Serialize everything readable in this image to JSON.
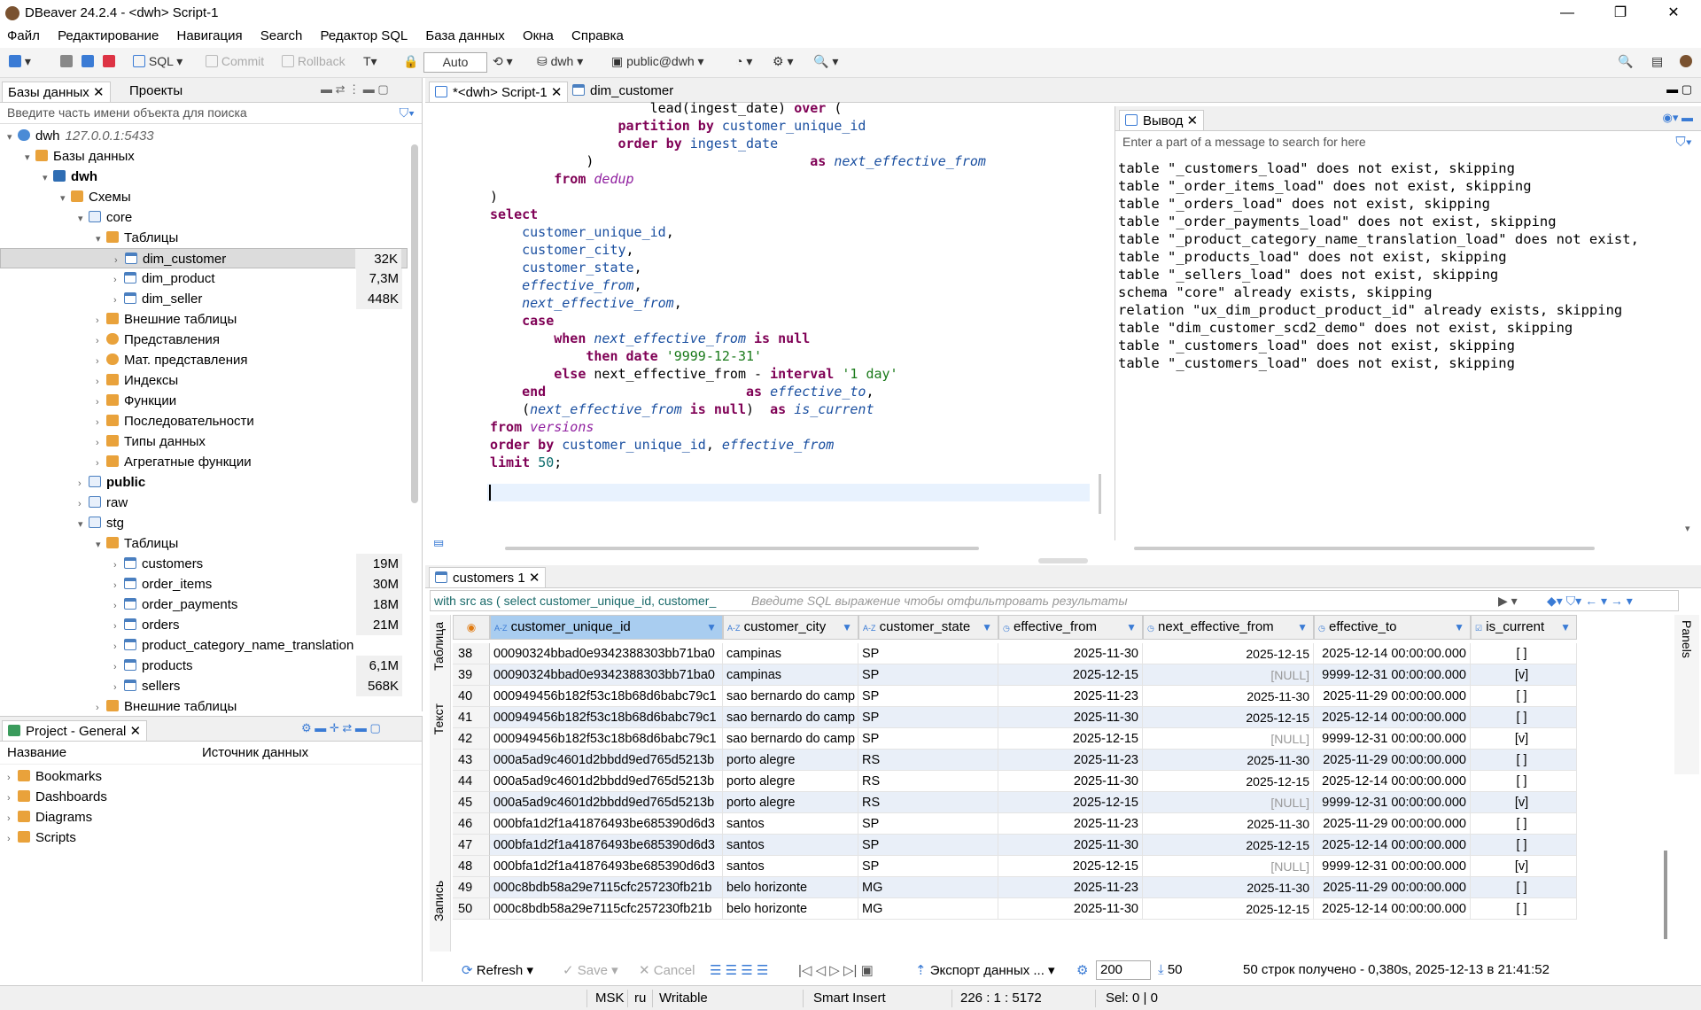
{
  "window": {
    "title": "DBeaver 24.2.4 - <dwh> Script-1"
  },
  "menu": [
    "Файл",
    "Редактирование",
    "Навигация",
    "Search",
    "Редактор SQL",
    "База данных",
    "Окна",
    "Справка"
  ],
  "toolbar": {
    "sql": "SQL",
    "commit": "Commit",
    "rollback": "Rollback",
    "mode": "Auto",
    "datasource": "dwh",
    "schema": "public@dwh"
  },
  "left": {
    "tab_db": "Базы данных",
    "tab_projects": "Проекты",
    "search_placeholder": "Введите часть имени объекта для поиска",
    "tree": [
      {
        "label": "dwh",
        "extra": "127.0.0.1:5433",
        "level": 0,
        "icon": "conn",
        "open": true
      },
      {
        "label": "Базы данных",
        "level": 1,
        "icon": "fold",
        "open": true
      },
      {
        "label": "dwh",
        "level": 2,
        "icon": "db",
        "open": true,
        "bold": true
      },
      {
        "label": "Схемы",
        "level": 3,
        "icon": "fold",
        "open": true
      },
      {
        "label": "core",
        "level": 4,
        "icon": "schema",
        "open": true
      },
      {
        "label": "Таблицы",
        "level": 5,
        "icon": "fold",
        "open": true
      },
      {
        "label": "dim_customer",
        "level": 6,
        "icon": "table",
        "size": "32K",
        "sel": true
      },
      {
        "label": "dim_product",
        "level": 6,
        "icon": "table",
        "size": "7,3M"
      },
      {
        "label": "dim_seller",
        "level": 6,
        "icon": "table",
        "size": "448K"
      },
      {
        "label": "Внешние таблицы",
        "level": 5,
        "icon": "fold"
      },
      {
        "label": "Представления",
        "level": 5,
        "icon": "view"
      },
      {
        "label": "Мат. представления",
        "level": 5,
        "icon": "view"
      },
      {
        "label": "Индексы",
        "level": 5,
        "icon": "fold"
      },
      {
        "label": "Функции",
        "level": 5,
        "icon": "fold"
      },
      {
        "label": "Последовательности",
        "level": 5,
        "icon": "fold"
      },
      {
        "label": "Типы данных",
        "level": 5,
        "icon": "fold"
      },
      {
        "label": "Агрегатные функции",
        "level": 5,
        "icon": "fold"
      },
      {
        "label": "public",
        "level": 4,
        "icon": "schema",
        "bold": true
      },
      {
        "label": "raw",
        "level": 4,
        "icon": "schema"
      },
      {
        "label": "stg",
        "level": 4,
        "icon": "schema",
        "open": true
      },
      {
        "label": "Таблицы",
        "level": 5,
        "icon": "fold",
        "open": true
      },
      {
        "label": "customers",
        "level": 6,
        "icon": "table",
        "size": "19M"
      },
      {
        "label": "order_items",
        "level": 6,
        "icon": "table",
        "size": "30M"
      },
      {
        "label": "order_payments",
        "level": 6,
        "icon": "table",
        "size": "18M"
      },
      {
        "label": "orders",
        "level": 6,
        "icon": "table",
        "size": "21M"
      },
      {
        "label": "product_category_name_translation",
        "level": 6,
        "icon": "table"
      },
      {
        "label": "products",
        "level": 6,
        "icon": "table",
        "size": "6,1M"
      },
      {
        "label": "sellers",
        "level": 6,
        "icon": "table",
        "size": "568K"
      },
      {
        "label": "Внешние таблицы",
        "level": 5,
        "icon": "fold"
      }
    ]
  },
  "project": {
    "tab": "Project - General",
    "col_name": "Название",
    "col_source": "Источник данных",
    "items": [
      "Bookmarks",
      "Dashboards",
      "Diagrams",
      "Scripts"
    ]
  },
  "editor": {
    "tab1": "*<dwh> Script-1",
    "tab2": "dim_customer"
  },
  "output": {
    "tab": "Вывод",
    "search_placeholder": "Enter a part of a message to search for here",
    "lines": [
      "table \"_customers_load\" does not exist, skipping",
      "table \"_order_items_load\" does not exist, skipping",
      "table \"_orders_load\" does not exist, skipping",
      "table \"_order_payments_load\" does not exist, skipping",
      "table \"_product_category_name_translation_load\" does not exist,",
      "table \"_products_load\" does not exist, skipping",
      "table \"_sellers_load\" does not exist, skipping",
      "schema \"core\" already exists, skipping",
      "relation \"ux_dim_product_product_id\" already exists, skipping",
      "table \"dim_customer_scd2_demo\" does not exist, skipping",
      "table \"_customers_load\" does not exist, skipping",
      "table \"_customers_load\" does not exist, skipping"
    ]
  },
  "results": {
    "tab": "customers 1",
    "query": "with src as ( select customer_unique_id, customer_",
    "filter_placeholder": "Введите SQL выражение чтобы отфильтровать результаты",
    "side_table": "Таблица",
    "side_text": "Текст",
    "side_record": "Запись",
    "side_panels": "Panels",
    "columns": [
      "customer_unique_id",
      "customer_city",
      "customer_state",
      "effective_from",
      "next_effective_from",
      "effective_to",
      "is_current"
    ],
    "rows": [
      [
        "38",
        "00090324bbad0e9342388303bb71ba0",
        "campinas",
        "SP",
        "2025-11-30",
        "2025-12-15",
        "2025-12-14 00:00:00.000",
        "[ ]"
      ],
      [
        "39",
        "00090324bbad0e9342388303bb71ba0",
        "campinas",
        "SP",
        "2025-12-15",
        "[NULL]",
        "9999-12-31 00:00:00.000",
        "[v]"
      ],
      [
        "40",
        "000949456b182f53c18b68d6babc79c1",
        "sao bernardo do camp",
        "SP",
        "2025-11-23",
        "2025-11-30",
        "2025-11-29 00:00:00.000",
        "[ ]"
      ],
      [
        "41",
        "000949456b182f53c18b68d6babc79c1",
        "sao bernardo do camp",
        "SP",
        "2025-11-30",
        "2025-12-15",
        "2025-12-14 00:00:00.000",
        "[ ]"
      ],
      [
        "42",
        "000949456b182f53c18b68d6babc79c1",
        "sao bernardo do camp",
        "SP",
        "2025-12-15",
        "[NULL]",
        "9999-12-31 00:00:00.000",
        "[v]"
      ],
      [
        "43",
        "000a5ad9c4601d2bbdd9ed765d5213b",
        "porto alegre",
        "RS",
        "2025-11-23",
        "2025-11-30",
        "2025-11-29 00:00:00.000",
        "[ ]"
      ],
      [
        "44",
        "000a5ad9c4601d2bbdd9ed765d5213b",
        "porto alegre",
        "RS",
        "2025-11-30",
        "2025-12-15",
        "2025-12-14 00:00:00.000",
        "[ ]"
      ],
      [
        "45",
        "000a5ad9c4601d2bbdd9ed765d5213b",
        "porto alegre",
        "RS",
        "2025-12-15",
        "[NULL]",
        "9999-12-31 00:00:00.000",
        "[v]"
      ],
      [
        "46",
        "000bfa1d2f1a41876493be685390d6d3",
        "santos",
        "SP",
        "2025-11-23",
        "2025-11-30",
        "2025-11-29 00:00:00.000",
        "[ ]"
      ],
      [
        "47",
        "000bfa1d2f1a41876493be685390d6d3",
        "santos",
        "SP",
        "2025-11-30",
        "2025-12-15",
        "2025-12-14 00:00:00.000",
        "[ ]"
      ],
      [
        "48",
        "000bfa1d2f1a41876493be685390d6d3",
        "santos",
        "SP",
        "2025-12-15",
        "[NULL]",
        "9999-12-31 00:00:00.000",
        "[v]"
      ],
      [
        "49",
        "000c8bdb58a29e7115cfc257230fb21b",
        "belo horizonte",
        "MG",
        "2025-11-23",
        "2025-11-30",
        "2025-11-29 00:00:00.000",
        "[ ]"
      ],
      [
        "50",
        "000c8bdb58a29e7115cfc257230fb21b",
        "belo horizonte",
        "MG",
        "2025-11-30",
        "2025-12-15",
        "2025-12-14 00:00:00.000",
        "[ ]"
      ]
    ],
    "bottom": {
      "refresh": "Refresh",
      "save": "Save",
      "cancel": "Cancel",
      "export": "Экспорт данных ...",
      "fetch": "200",
      "count": "50",
      "info": "50 строк получено - 0,380s, 2025-12-13 в 21:41:52"
    }
  },
  "status": {
    "tz": "MSK",
    "lang": "ru",
    "mode": "Writable",
    "insert": "Smart Insert",
    "pos": "226 : 1 : 5172",
    "sel": "Sel: 0 | 0"
  }
}
